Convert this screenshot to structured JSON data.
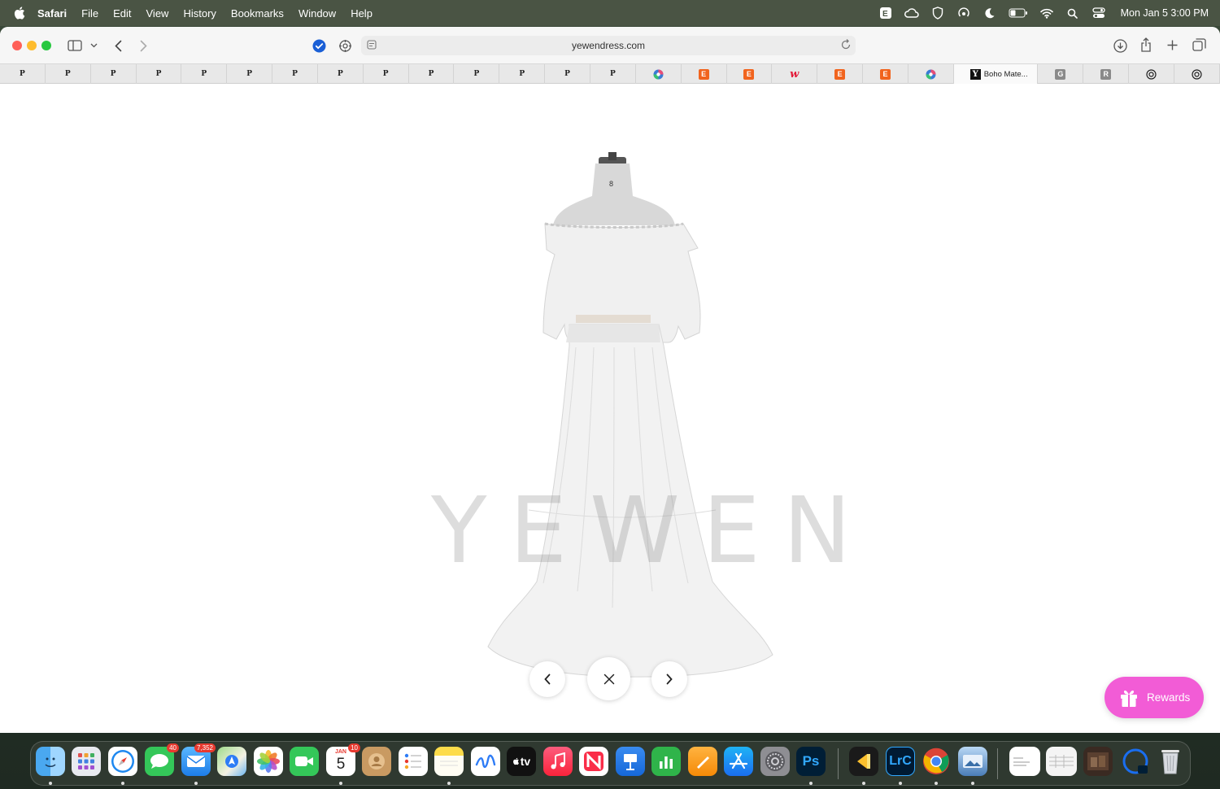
{
  "menubar": {
    "app_name": "Safari",
    "items": [
      "File",
      "Edit",
      "View",
      "History",
      "Bookmarks",
      "Window",
      "Help"
    ],
    "clock": "Mon Jan 5  3:00 PM"
  },
  "toolbar": {
    "url": "yewendress.com"
  },
  "favorites": {
    "p_label": "P",
    "e_label": "E",
    "w_label": "w",
    "g_label": "G",
    "r_label": "R",
    "y_label": "Y",
    "active_tab_label": "Boho Mate..."
  },
  "content": {
    "watermark": "YEWEN",
    "mannequin_size": "8",
    "rewards_label": "Rewards"
  },
  "dock": {
    "messages_badge": "40",
    "mail_badge": "7,352",
    "calendar_month": "JAN",
    "calendar_day": "5",
    "calendar_badge": "10",
    "tv_label": "tv",
    "ps_label": "Ps",
    "lrc_label": "LrC"
  },
  "colors": {
    "rewards": "#f25cd6",
    "close": "#ff5f57",
    "minimize": "#febc2e",
    "zoom": "#28c840"
  }
}
